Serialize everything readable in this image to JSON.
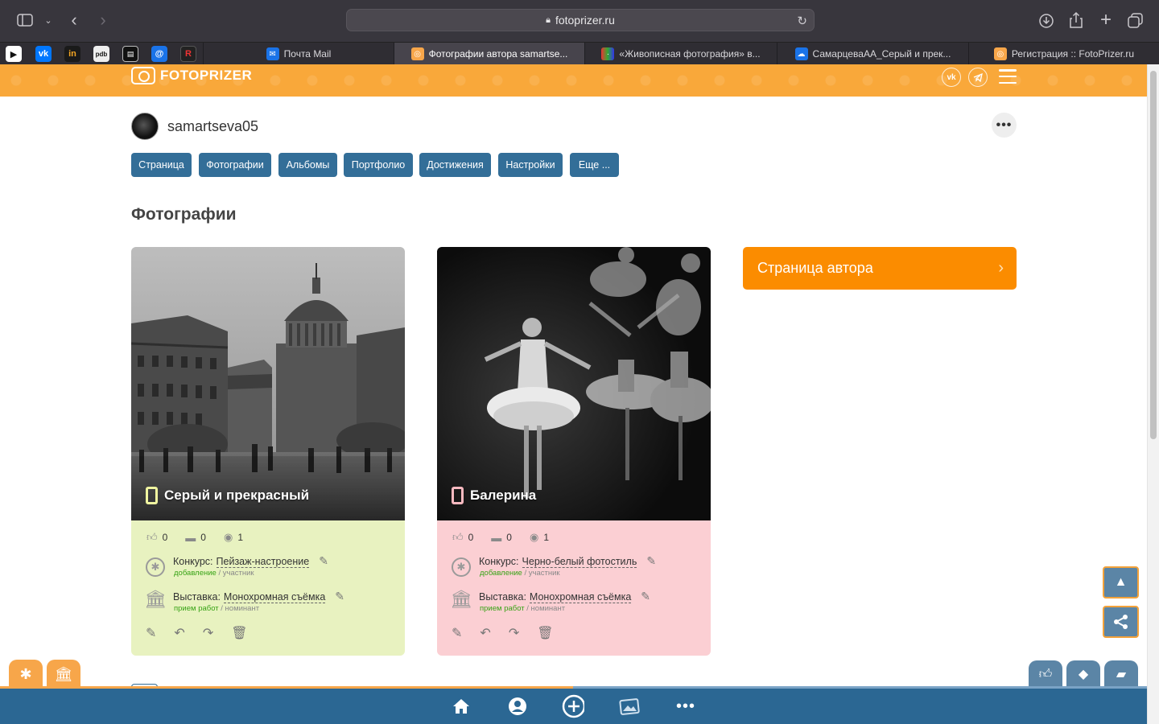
{
  "browser": {
    "url": "fotoprizer.ru",
    "tabs": [
      {
        "title": "Почта Mail"
      },
      {
        "title": "Фотографии автора samartse..."
      },
      {
        "title": "«Живописная фотография» в..."
      },
      {
        "title": "СамарцеваАА_Серый и прек..."
      },
      {
        "title": "Регистрация :: FotoPrizer.ru"
      }
    ],
    "pinned": [
      "yt",
      "vk",
      "in",
      "pdb",
      "sh",
      "@",
      "R"
    ]
  },
  "site": {
    "logo_text": "FOTOPRIZER",
    "header_vk": "vk",
    "header_tg": "tg"
  },
  "profile": {
    "username": "samartseva05",
    "more_label": "•••"
  },
  "nav": [
    "Страница",
    "Фотографии",
    "Альбомы",
    "Портфолио",
    "Достижения",
    "Настройки",
    "Еще ..."
  ],
  "page_title": "Фотографии",
  "cards": [
    {
      "title": "Серый и прекрасный",
      "likes": "0",
      "comments": "0",
      "views": "1",
      "contest_label": "Конкурс:",
      "contest_name": "Пейзаж-настроение",
      "contest_stage": "добавление",
      "contest_role": "участник",
      "exhibit_label": "Выставка:",
      "exhibit_name": "Монохромная съёмка",
      "exhibit_stage": "прием работ",
      "exhibit_role": "номинант",
      "bg_color": "#e8f2c0"
    },
    {
      "title": "Балерина",
      "likes": "0",
      "comments": "0",
      "views": "1",
      "contest_label": "Конкурс:",
      "contest_name": "Черно-белый фотостиль",
      "contest_stage": "добавление",
      "contest_role": "участник",
      "exhibit_label": "Выставка:",
      "exhibit_name": "Монохромная съёмка",
      "exhibit_stage": "прием работ",
      "exhibit_role": "номинант",
      "bg_color": "#fbcfd3"
    }
  ],
  "sidebar": {
    "author_page": "Страница автора"
  },
  "colors": {
    "header_orange": "#f9a83a",
    "nav_blue": "#336e98",
    "author_btn": "#fb8c00",
    "bottom_nav": "#2b6793"
  }
}
